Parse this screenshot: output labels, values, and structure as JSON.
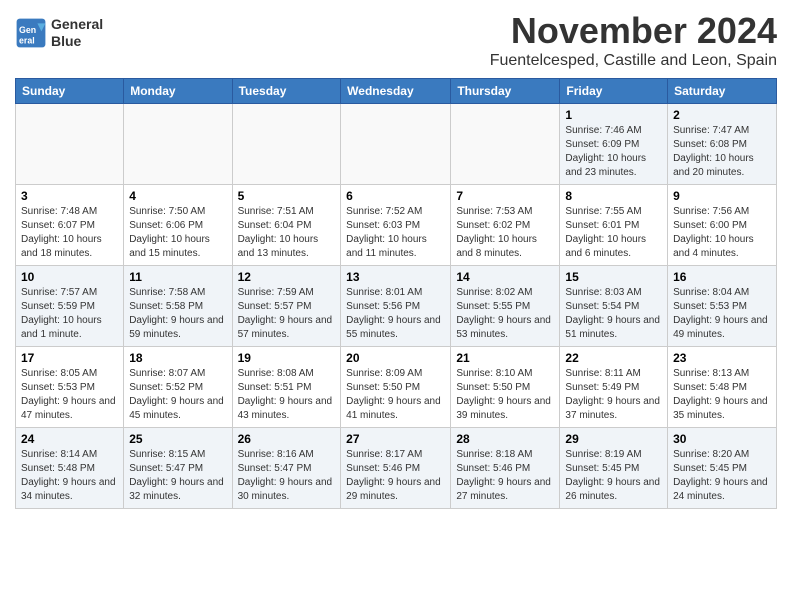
{
  "logo": {
    "line1": "General",
    "line2": "Blue"
  },
  "title": "November 2024",
  "location": "Fuentelcesped, Castille and Leon, Spain",
  "weekdays": [
    "Sunday",
    "Monday",
    "Tuesday",
    "Wednesday",
    "Thursday",
    "Friday",
    "Saturday"
  ],
  "weeks": [
    [
      {
        "day": "",
        "info": ""
      },
      {
        "day": "",
        "info": ""
      },
      {
        "day": "",
        "info": ""
      },
      {
        "day": "",
        "info": ""
      },
      {
        "day": "",
        "info": ""
      },
      {
        "day": "1",
        "info": "Sunrise: 7:46 AM\nSunset: 6:09 PM\nDaylight: 10 hours and 23 minutes."
      },
      {
        "day": "2",
        "info": "Sunrise: 7:47 AM\nSunset: 6:08 PM\nDaylight: 10 hours and 20 minutes."
      }
    ],
    [
      {
        "day": "3",
        "info": "Sunrise: 7:48 AM\nSunset: 6:07 PM\nDaylight: 10 hours and 18 minutes."
      },
      {
        "day": "4",
        "info": "Sunrise: 7:50 AM\nSunset: 6:06 PM\nDaylight: 10 hours and 15 minutes."
      },
      {
        "day": "5",
        "info": "Sunrise: 7:51 AM\nSunset: 6:04 PM\nDaylight: 10 hours and 13 minutes."
      },
      {
        "day": "6",
        "info": "Sunrise: 7:52 AM\nSunset: 6:03 PM\nDaylight: 10 hours and 11 minutes."
      },
      {
        "day": "7",
        "info": "Sunrise: 7:53 AM\nSunset: 6:02 PM\nDaylight: 10 hours and 8 minutes."
      },
      {
        "day": "8",
        "info": "Sunrise: 7:55 AM\nSunset: 6:01 PM\nDaylight: 10 hours and 6 minutes."
      },
      {
        "day": "9",
        "info": "Sunrise: 7:56 AM\nSunset: 6:00 PM\nDaylight: 10 hours and 4 minutes."
      }
    ],
    [
      {
        "day": "10",
        "info": "Sunrise: 7:57 AM\nSunset: 5:59 PM\nDaylight: 10 hours and 1 minute."
      },
      {
        "day": "11",
        "info": "Sunrise: 7:58 AM\nSunset: 5:58 PM\nDaylight: 9 hours and 59 minutes."
      },
      {
        "day": "12",
        "info": "Sunrise: 7:59 AM\nSunset: 5:57 PM\nDaylight: 9 hours and 57 minutes."
      },
      {
        "day": "13",
        "info": "Sunrise: 8:01 AM\nSunset: 5:56 PM\nDaylight: 9 hours and 55 minutes."
      },
      {
        "day": "14",
        "info": "Sunrise: 8:02 AM\nSunset: 5:55 PM\nDaylight: 9 hours and 53 minutes."
      },
      {
        "day": "15",
        "info": "Sunrise: 8:03 AM\nSunset: 5:54 PM\nDaylight: 9 hours and 51 minutes."
      },
      {
        "day": "16",
        "info": "Sunrise: 8:04 AM\nSunset: 5:53 PM\nDaylight: 9 hours and 49 minutes."
      }
    ],
    [
      {
        "day": "17",
        "info": "Sunrise: 8:05 AM\nSunset: 5:53 PM\nDaylight: 9 hours and 47 minutes."
      },
      {
        "day": "18",
        "info": "Sunrise: 8:07 AM\nSunset: 5:52 PM\nDaylight: 9 hours and 45 minutes."
      },
      {
        "day": "19",
        "info": "Sunrise: 8:08 AM\nSunset: 5:51 PM\nDaylight: 9 hours and 43 minutes."
      },
      {
        "day": "20",
        "info": "Sunrise: 8:09 AM\nSunset: 5:50 PM\nDaylight: 9 hours and 41 minutes."
      },
      {
        "day": "21",
        "info": "Sunrise: 8:10 AM\nSunset: 5:50 PM\nDaylight: 9 hours and 39 minutes."
      },
      {
        "day": "22",
        "info": "Sunrise: 8:11 AM\nSunset: 5:49 PM\nDaylight: 9 hours and 37 minutes."
      },
      {
        "day": "23",
        "info": "Sunrise: 8:13 AM\nSunset: 5:48 PM\nDaylight: 9 hours and 35 minutes."
      }
    ],
    [
      {
        "day": "24",
        "info": "Sunrise: 8:14 AM\nSunset: 5:48 PM\nDaylight: 9 hours and 34 minutes."
      },
      {
        "day": "25",
        "info": "Sunrise: 8:15 AM\nSunset: 5:47 PM\nDaylight: 9 hours and 32 minutes."
      },
      {
        "day": "26",
        "info": "Sunrise: 8:16 AM\nSunset: 5:47 PM\nDaylight: 9 hours and 30 minutes."
      },
      {
        "day": "27",
        "info": "Sunrise: 8:17 AM\nSunset: 5:46 PM\nDaylight: 9 hours and 29 minutes."
      },
      {
        "day": "28",
        "info": "Sunrise: 8:18 AM\nSunset: 5:46 PM\nDaylight: 9 hours and 27 minutes."
      },
      {
        "day": "29",
        "info": "Sunrise: 8:19 AM\nSunset: 5:45 PM\nDaylight: 9 hours and 26 minutes."
      },
      {
        "day": "30",
        "info": "Sunrise: 8:20 AM\nSunset: 5:45 PM\nDaylight: 9 hours and 24 minutes."
      }
    ]
  ]
}
